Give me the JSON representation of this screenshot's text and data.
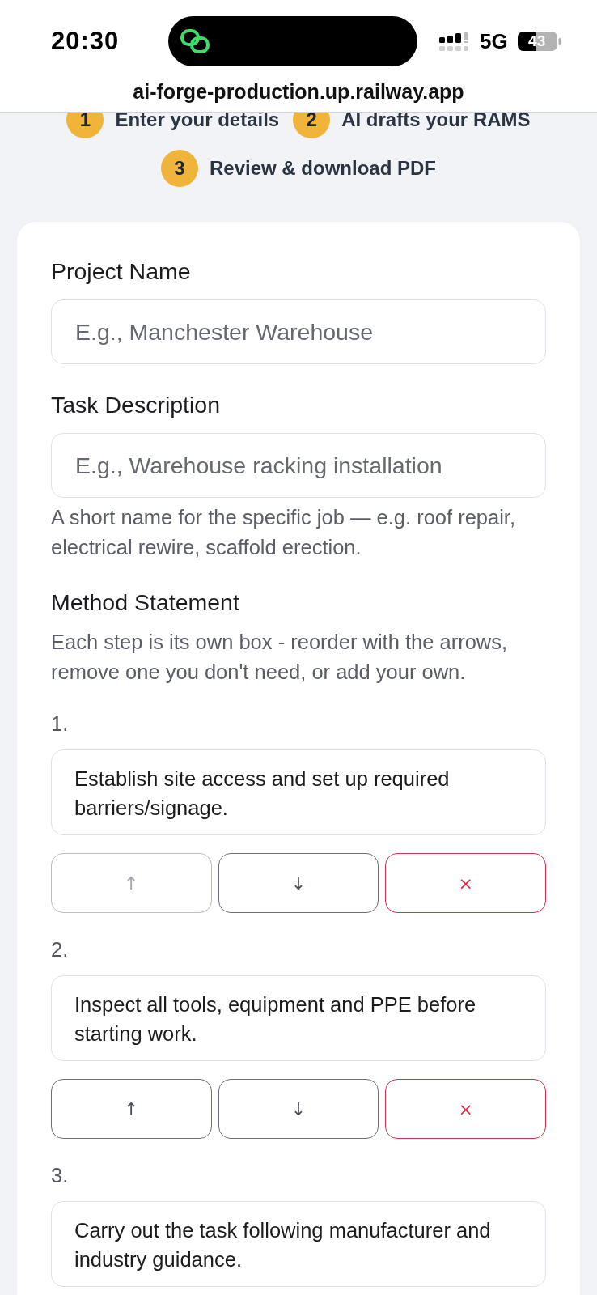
{
  "status_bar": {
    "time": "20:30",
    "network": "5G",
    "battery": "43"
  },
  "browser": {
    "url": "ai-forge-production.up.railway.app"
  },
  "steps": [
    {
      "number": "1",
      "label": "Enter your details"
    },
    {
      "number": "2",
      "label": "AI drafts your RAMS"
    },
    {
      "number": "3",
      "label": "Review & download PDF"
    }
  ],
  "form": {
    "fields": [
      {
        "label": "Project Name",
        "placeholder": "E.g., Manchester Warehouse"
      },
      {
        "label": "Task Description",
        "placeholder": "E.g., Warehouse racking installation",
        "hint": "A short name for the specific job — e.g. roof repair, electrical rewire, scaffold erection."
      }
    ],
    "method_statement": {
      "title": "Method Statement",
      "description": "Each step is its own box - reorder with the arrows, remove one you don't need, or add your own.",
      "steps": [
        {
          "number": "1.",
          "text": "Establish site access and set up required barriers/signage.",
          "buttons": [
            {
              "kind": "up",
              "label": "↑",
              "disabled": true
            },
            {
              "kind": "down",
              "label": "↓",
              "disabled": false
            },
            {
              "kind": "remove",
              "label": "×",
              "disabled": false
            }
          ]
        },
        {
          "number": "2.",
          "text": "Inspect all tools, equipment and PPE before starting work.",
          "buttons": [
            {
              "kind": "up",
              "label": "↑",
              "disabled": false
            },
            {
              "kind": "down",
              "label": "↓",
              "disabled": false
            },
            {
              "kind": "remove",
              "label": "×",
              "disabled": false
            }
          ]
        },
        {
          "number": "3.",
          "text": "Carry out the task following manufacturer and industry guidance."
        }
      ]
    }
  }
}
